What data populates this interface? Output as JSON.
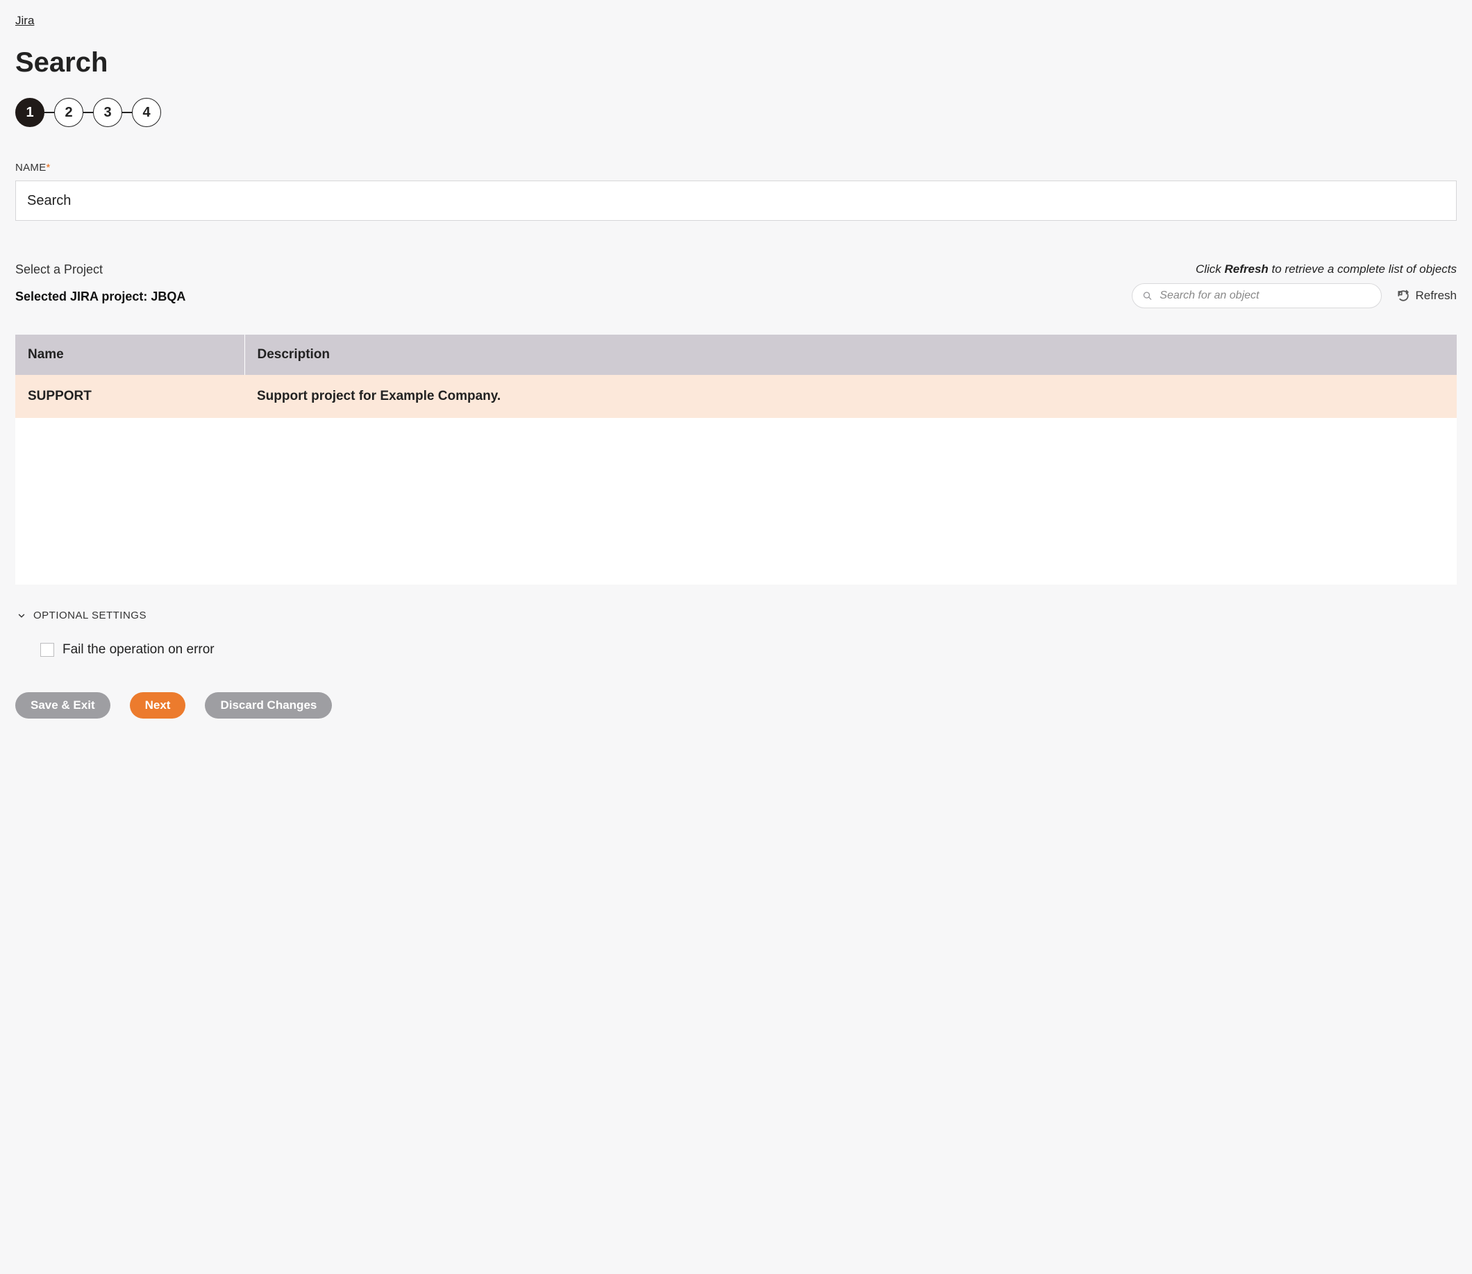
{
  "breadcrumb": {
    "link_text": "Jira"
  },
  "page_title": "Search",
  "stepper": {
    "steps": [
      "1",
      "2",
      "3",
      "4"
    ],
    "active_index": 0
  },
  "fields": {
    "name_label": "NAME",
    "name_value": "Search"
  },
  "project_section": {
    "select_label": "Select a Project",
    "selected_prefix": "Selected JIRA project: ",
    "selected_value": "JBQA",
    "hint_pre": "Click ",
    "hint_bold": "Refresh",
    "hint_post": " to retrieve a complete list of objects",
    "search_placeholder": "Search for an object",
    "refresh_label": "Refresh"
  },
  "table": {
    "headers": {
      "name": "Name",
      "description": "Description"
    },
    "rows": [
      {
        "name": "SUPPORT",
        "description": "Support project for Example Company.",
        "selected": true
      }
    ]
  },
  "optional": {
    "toggle_label": "OPTIONAL SETTINGS",
    "checkbox_label": "Fail the operation on error",
    "checkbox_checked": false
  },
  "buttons": {
    "save_exit": "Save & Exit",
    "next": "Next",
    "discard": "Discard Changes"
  }
}
